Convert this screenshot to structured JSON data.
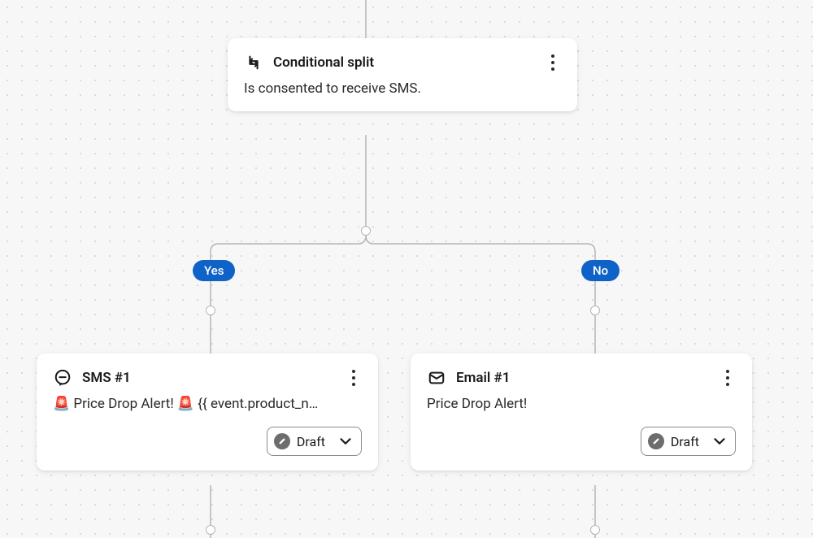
{
  "split": {
    "title": "Conditional split",
    "description": "Is consented to receive SMS."
  },
  "branches": {
    "yes_label": "Yes",
    "no_label": "No"
  },
  "sms": {
    "title": "SMS #1",
    "body": "🚨 Price Drop Alert! 🚨 {{ event.product_n…",
    "status": "Draft"
  },
  "email": {
    "title": "Email #1",
    "body": "Price Drop Alert!",
    "status": "Draft"
  }
}
